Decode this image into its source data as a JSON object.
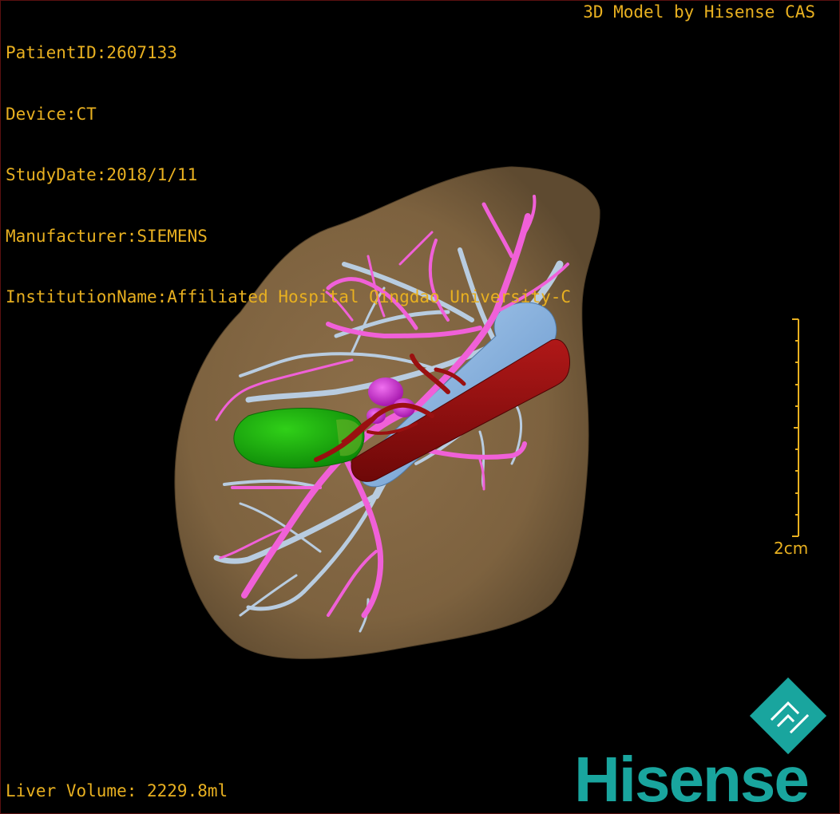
{
  "patient_info": {
    "patient_id": "PatientID:2607133",
    "device": "Device:CT",
    "study_date": "StudyDate:2018/1/11",
    "manufacturer": "Manufacturer:SIEMENS",
    "institution": "InstitutionName:Affiliated Hospital Qingdao University-C"
  },
  "header_right": "3D Model by Hisense CAS",
  "volume": "Liver Volume: 2229.8ml",
  "scale": {
    "label": "2cm"
  },
  "brand": {
    "name": "Hisense",
    "color": "#19a59e"
  },
  "colors": {
    "text": "#e8b020",
    "liver": "#8b6d48",
    "portal_vein": "#f060d8",
    "hepatic_vein": "#b8cce0",
    "ivc": "#8ab8e8",
    "artery": "#a01010",
    "gallbladder": "#22b012",
    "tumor": "#d020d8"
  }
}
